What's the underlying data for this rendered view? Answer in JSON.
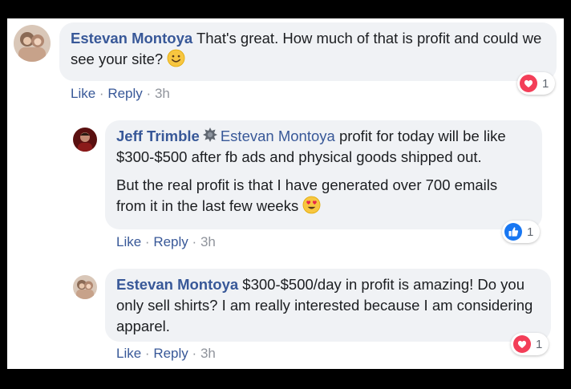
{
  "comments": [
    {
      "author": "Estevan Montoya",
      "text": "That's great. How much of that is profit and could we see your site?",
      "emoji": "slightly-smiling-face",
      "actions": {
        "like": "Like",
        "reply": "Reply",
        "time": "3h"
      },
      "reaction": {
        "type": "love",
        "count": "1",
        "color": "#f33e58"
      }
    },
    {
      "author": "Jeff Trimble",
      "tagged": "Estevan Montoya",
      "paragraph1": "profit for today will be like $300-$500 after fb ads and physical goods shipped out.",
      "paragraph2": "But the real profit is that I have generated over 700 emails from it in the last few weeks",
      "emoji": "heart-eyes",
      "actions": {
        "like": "Like",
        "reply": "Reply",
        "time": "3h"
      },
      "reaction": {
        "type": "like",
        "count": "1",
        "color": "#1877f2"
      }
    },
    {
      "author": "Estevan Montoya",
      "text": "$300-$500/day in profit is amazing! Do you only sell shirts? I am really interested because I am considering apparel.",
      "actions": {
        "like": "Like",
        "reply": "Reply",
        "time": "3h"
      },
      "reaction": {
        "type": "love",
        "count": "1",
        "color": "#f33e58"
      }
    }
  ],
  "separator": "·",
  "colors": {
    "link": "#385898",
    "bubble": "#f0f2f5",
    "meta": "#90949c"
  }
}
